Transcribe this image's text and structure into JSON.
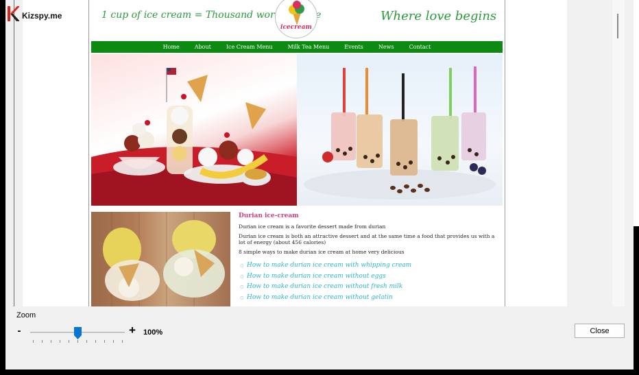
{
  "brand": {
    "name": "Kizspy.me",
    "accent": "#e0241b"
  },
  "webpage": {
    "tagline_left": "1 cup of ice cream = Thousand words of love",
    "logo_text": "icecream",
    "tagline_right": "Where love begins",
    "nav": [
      "Home",
      "About",
      "Ice Cream Menu",
      "Milk Tea Menu",
      "Events",
      "News",
      "Contact"
    ],
    "nav_color": "#0d8a12",
    "article": {
      "title": "Durian ice-cream",
      "p1": "Durian ice cream is a favorite dessert made from durian",
      "p2": "Durian ice cream is both an attractive dessert and at the same time a food that provides us with a lot of energy (about 456 calories)",
      "p3": "8 simple ways to make durian ice cream at home very delicious",
      "links": [
        "How to make durian ice cream with whipping cream",
        "How to make durian ice cream without eggs",
        "How to make durian ice cream without fresh milk",
        "How to make durian ice cream without gelatin"
      ]
    }
  },
  "zoom": {
    "label": "Zoom",
    "minus": "-",
    "plus": "+",
    "value_text": "100%",
    "slider_fraction": 0.5
  },
  "close_label": "Close",
  "icons": {
    "brand_logo": "k-logo-icon",
    "cone": "ice-cream-cone-icon"
  }
}
